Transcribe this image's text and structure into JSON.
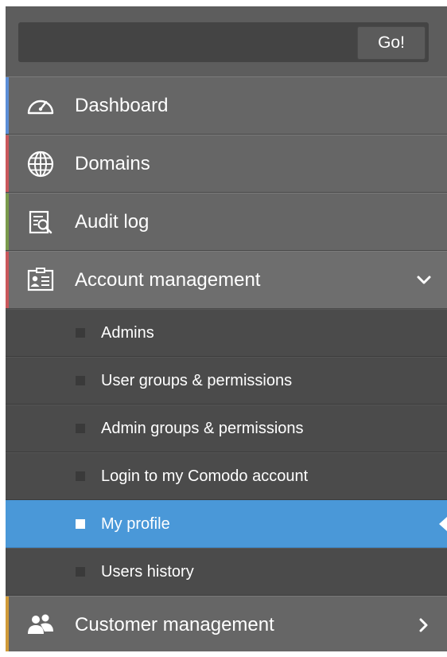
{
  "search": {
    "placeholder": "",
    "value": "",
    "button_label": "Go!"
  },
  "menu": [
    {
      "label": "Dashboard",
      "icon": "dashboard-gauge-icon",
      "accent": "#5b8ed6"
    },
    {
      "label": "Domains",
      "icon": "globe-icon",
      "accent": "#c9575b"
    },
    {
      "label": "Audit log",
      "icon": "audit-log-icon",
      "accent": "#7a9a4c"
    },
    {
      "label": "Account management",
      "icon": "account-card-icon",
      "accent": "#c9575b",
      "expanded": true
    },
    {
      "label": "Customer management",
      "icon": "customers-icon",
      "accent": "#d09a38",
      "expanded": false
    }
  ],
  "account_submenu": [
    {
      "label": "Admins"
    },
    {
      "label": "User groups & permissions"
    },
    {
      "label": "Admin groups & permissions"
    },
    {
      "label": "Login to my Comodo account"
    },
    {
      "label": "My profile",
      "selected": true
    },
    {
      "label": "Users history"
    }
  ],
  "colors": {
    "selected": "#4a98d8",
    "menu_bg": "#666666",
    "submenu_bg": "#4b4b4b"
  }
}
